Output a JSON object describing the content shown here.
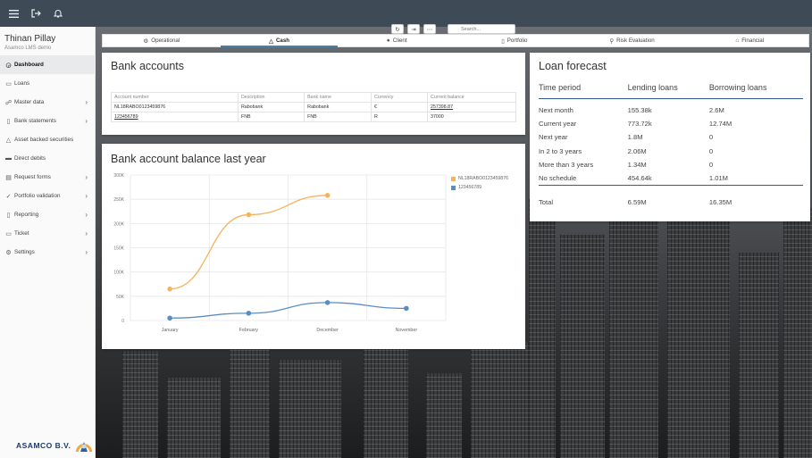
{
  "topbar": {
    "icons": [
      "menu-icon",
      "logout-icon",
      "bell-icon"
    ]
  },
  "sidebar": {
    "user_name": "Thinan Pillay",
    "user_sub": "Asamco LMS demo",
    "items": [
      {
        "label": "Dashboard",
        "icon": "dashboard-icon",
        "chevron": false
      },
      {
        "label": "Loans",
        "icon": "loans-icon",
        "chevron": false
      },
      {
        "label": "Master data",
        "icon": "master-data-icon",
        "chevron": true
      },
      {
        "label": "Bank statements",
        "icon": "document-icon",
        "chevron": true
      },
      {
        "label": "Asset backed securities",
        "icon": "warning-icon",
        "chevron": false
      },
      {
        "label": "Direct debits",
        "icon": "card-icon",
        "chevron": false
      },
      {
        "label": "Request forms",
        "icon": "form-icon",
        "chevron": true
      },
      {
        "label": "Portfolio validation",
        "icon": "check-icon",
        "chevron": true
      },
      {
        "label": "Reporting",
        "icon": "report-icon",
        "chevron": true
      },
      {
        "label": "Ticket",
        "icon": "ticket-icon",
        "chevron": true
      },
      {
        "label": "Settings",
        "icon": "gear-icon",
        "chevron": true
      }
    ],
    "logo_text": "ASAMCO B.V."
  },
  "tabs": [
    {
      "label": "Operational",
      "icon": "operational-icon"
    },
    {
      "label": "Cash",
      "icon": "cash-icon"
    },
    {
      "label": "Client",
      "icon": "client-icon"
    },
    {
      "label": "Portfolio",
      "icon": "portfolio-icon"
    },
    {
      "label": "Risk Evaluation",
      "icon": "search-icon"
    },
    {
      "label": "Financial",
      "icon": "financial-icon"
    }
  ],
  "bank_accounts": {
    "title": "Bank accounts",
    "search_placeholder": "Search...",
    "columns": [
      "Account number",
      "Description",
      "Bank name",
      "Currency",
      "Current balance"
    ],
    "rows": [
      [
        "NL18RABO0123459876",
        "Rabobank",
        "Rabobank",
        "€",
        "257398.87"
      ],
      [
        "123456789",
        "FNB",
        "FNB",
        "R",
        "37000"
      ]
    ]
  },
  "balance_chart": {
    "title": "Bank account balance last year"
  },
  "chart_data": {
    "type": "line",
    "title": "Bank account balance last year",
    "categories": [
      "January",
      "February",
      "December",
      "November"
    ],
    "series": [
      {
        "name": "NL18RABO0123459876",
        "color": "#f5b35c",
        "values": [
          65000,
          218000,
          258000,
          null
        ]
      },
      {
        "name": "123456789",
        "color": "#5b8ec0",
        "values": [
          5000,
          15000,
          37000,
          25000
        ]
      }
    ],
    "yticks": [
      "0",
      "50K",
      "100K",
      "150K",
      "200K",
      "250K",
      "300K"
    ],
    "ylim": [
      0,
      300000
    ],
    "grid": true,
    "legend": "top-right"
  },
  "loan_forecast": {
    "title": "Loan forecast",
    "columns": [
      "Time period",
      "Lending loans",
      "Borrowing loans"
    ],
    "rows": [
      [
        "Next month",
        "155.38k",
        "2.6M"
      ],
      [
        "Current year",
        "773.72k",
        "12.74M"
      ],
      [
        "Next year",
        "1.8M",
        "0"
      ],
      [
        "In 2 to 3 years",
        "2.06M",
        "0"
      ],
      [
        "More than 3 years",
        "1.34M",
        "0"
      ],
      [
        "No schedule",
        "454.64k",
        "1.01M"
      ]
    ],
    "total": [
      "Total",
      "6.59M",
      "16.35M"
    ]
  }
}
